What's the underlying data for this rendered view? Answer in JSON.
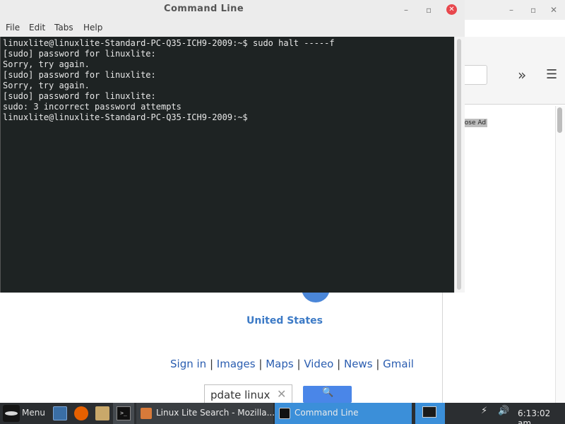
{
  "terminal": {
    "title": "Command Line",
    "menu": [
      "File",
      "Edit",
      "Tabs",
      "Help"
    ],
    "lines": [
      "linuxlite@linuxlite-Standard-PC-Q35-ICH9-2009:~$ sudo halt -----f",
      "[sudo] password for linuxlite:",
      "Sorry, try again.",
      "[sudo] password for linuxlite:",
      "Sorry, try again.",
      "[sudo] password for linuxlite:",
      "sudo: 3 incorrect password attempts",
      "linuxlite@linuxlite-Standard-PC-Q35-ICH9-2009:~$"
    ]
  },
  "browser": {
    "close_ad": "Close Ad",
    "country": "United States",
    "links": [
      "Sign in",
      "Images",
      "Maps",
      "Video",
      "News",
      "Gmail"
    ],
    "link_separator": "|",
    "search_value": "pdate linux"
  },
  "taskbar": {
    "menu_label": "Menu",
    "tasks": [
      "Linux Lite Search - Mozilla...",
      "Command Line"
    ],
    "clock": "6:13:02 am"
  },
  "colors": {
    "terminal_bg": "#1e2323",
    "taskbar_bg": "#2b2e31",
    "active_task": "#3b8fd9",
    "link": "#2a5db0",
    "close_button": "#e8474d"
  }
}
